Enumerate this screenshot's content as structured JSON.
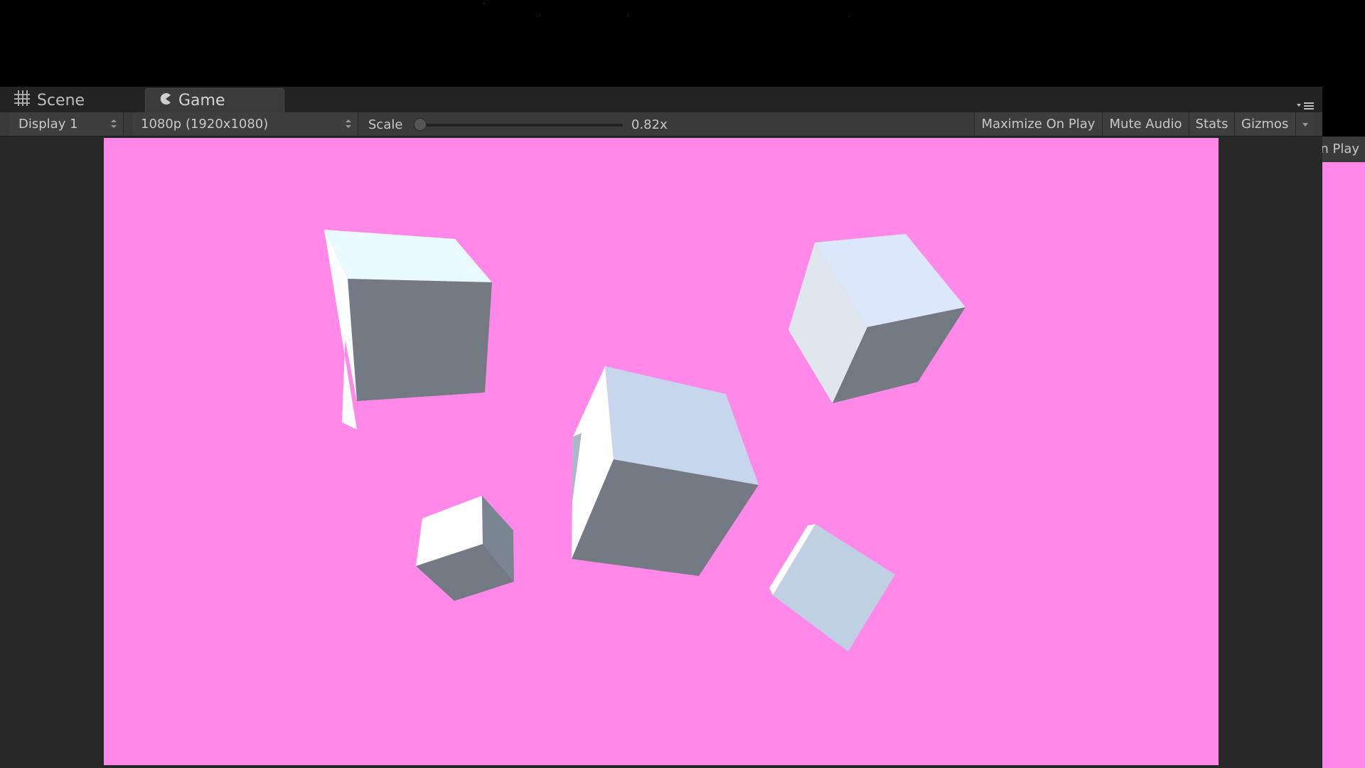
{
  "tabs": {
    "scene": {
      "label": "Scene",
      "icon": "grid-icon"
    },
    "game": {
      "label": "Game",
      "icon": "pacman-icon",
      "active": true
    }
  },
  "toolbar": {
    "display_label": "Display 1",
    "resolution_label": "1080p (1920x1080)",
    "scale_label": "Scale",
    "scale_value": "0.82x",
    "scale_fraction": 0.0,
    "maximize_label": "Maximize On Play",
    "mute_label": "Mute Audio",
    "stats_label": "Stats",
    "gizmos_label": "Gizmos"
  },
  "side_window": {
    "label": "n Play"
  },
  "colors": {
    "viewport_background": "#ff88e8",
    "editor_dark": "#282828",
    "toolbar": "#3a3a3a"
  }
}
